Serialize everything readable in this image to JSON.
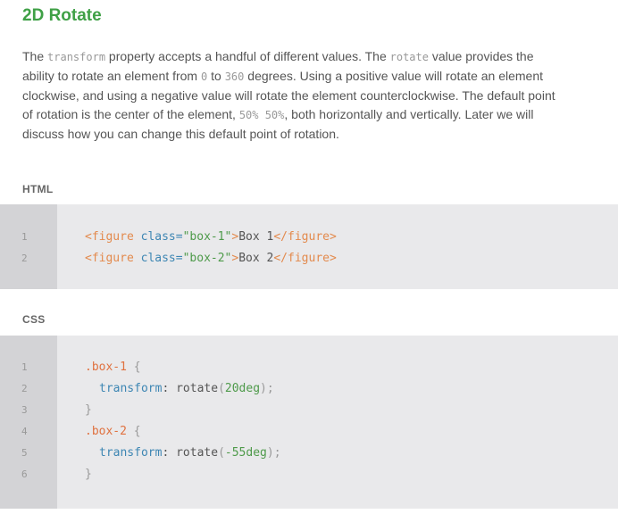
{
  "title": "2D Rotate",
  "paragraph": {
    "t1": "The ",
    "c1": "transform",
    "t2": " property accepts a handful of different values. The ",
    "c2": "rotate",
    "t3": " value provides the ability to rotate an element from ",
    "c3": "0",
    "t4": " to ",
    "c4": "360",
    "t5": " degrees. Using a positive value will rotate an element clockwise, and using a negative value will rotate the element counterclockwise. The default point of rotation is the center of the element, ",
    "c5": "50% 50%",
    "t6": ", both horizontally and vertically. Later we will discuss how you can change this default point of rotation."
  },
  "html_section": {
    "label": "HTML",
    "lines": [
      {
        "num": "1",
        "open_tag": "<figure",
        "attr": " class=",
        "value": "\"box-1\"",
        "close_bracket": ">",
        "text": "Box 1",
        "end_tag": "</figure>"
      },
      {
        "num": "2",
        "open_tag": "<figure",
        "attr": " class=",
        "value": "\"box-2\"",
        "close_bracket": ">",
        "text": "Box 2",
        "end_tag": "</figure>"
      }
    ]
  },
  "css_section": {
    "label": "CSS",
    "line_numbers": [
      "1",
      "2",
      "3",
      "4",
      "5",
      "6"
    ],
    "rule1": {
      "selector": ".box-1",
      "open": " {",
      "prop": "transform",
      "colon": ": ",
      "fn": "rotate",
      "paren_open": "(",
      "value": "20deg",
      "paren_close": ")",
      "semi": ";",
      "close": "}"
    },
    "rule2": {
      "selector": ".box-2",
      "open": " {",
      "prop": "transform",
      "colon": ": ",
      "fn": "rotate",
      "paren_open": "(",
      "value": "-55deg",
      "paren_close": ")",
      "semi": ";",
      "close": "}"
    }
  }
}
